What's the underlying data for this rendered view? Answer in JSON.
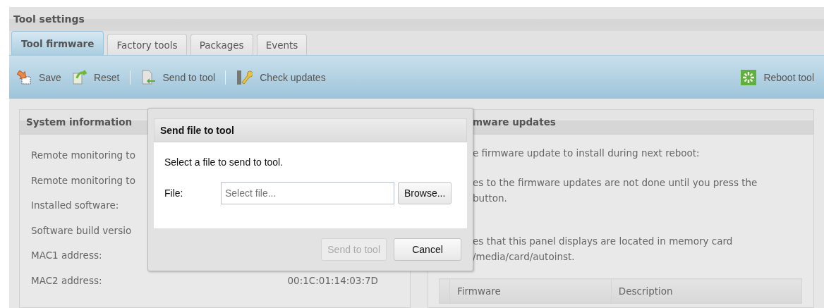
{
  "panel_title": "Tool settings",
  "tabs": [
    {
      "label": "Tool firmware",
      "selected": true
    },
    {
      "label": "Factory tools",
      "selected": false
    },
    {
      "label": "Packages",
      "selected": false
    },
    {
      "label": "Events",
      "selected": false
    }
  ],
  "toolbar": {
    "items": [
      {
        "label": "Save",
        "kind": "save",
        "separator_after": false
      },
      {
        "label": "Reset",
        "kind": "reset",
        "separator_after": true
      },
      {
        "label": "Send to tool",
        "kind": "send",
        "separator_after": true
      },
      {
        "label": "Check updates",
        "kind": "updates",
        "separator_after": false
      }
    ],
    "right_items": [
      {
        "label": "Reboot tool",
        "kind": "reboot",
        "separator_after": false
      }
    ]
  },
  "system_information": {
    "title": "System information",
    "rows": [
      {
        "label": "Remote monitoring to"
      },
      {
        "label": "Remote monitoring to"
      },
      {
        "label": "Installed software:"
      },
      {
        "label": "Software build versio"
      },
      {
        "label": "MAC1 address:"
      },
      {
        "label": "MAC2 address:",
        "value": "00:1C:01:14:03:7D"
      }
    ]
  },
  "firmware_updates": {
    "title": "mware updates",
    "paragraphs": [
      {
        "lines": [
          "e firmware update to install during next reboot:"
        ]
      },
      {
        "lines": [
          "es to the firmware updates are not done until you press the",
          "button."
        ]
      },
      {
        "lines": [
          "es that this panel displays are located in memory card",
          "/media/card/autoinst."
        ]
      }
    ],
    "table": {
      "columns": [
        "Firmware",
        "Description"
      ]
    }
  },
  "dialog": {
    "title": "Send file to tool",
    "message": "Select a file to send to tool.",
    "file_label": "File:",
    "file_placeholder": "Select file...",
    "browse_button": "Browse...",
    "buttons": [
      {
        "label": "Send to tool",
        "disabled": true
      },
      {
        "label": "Cancel",
        "disabled": false
      }
    ]
  }
}
